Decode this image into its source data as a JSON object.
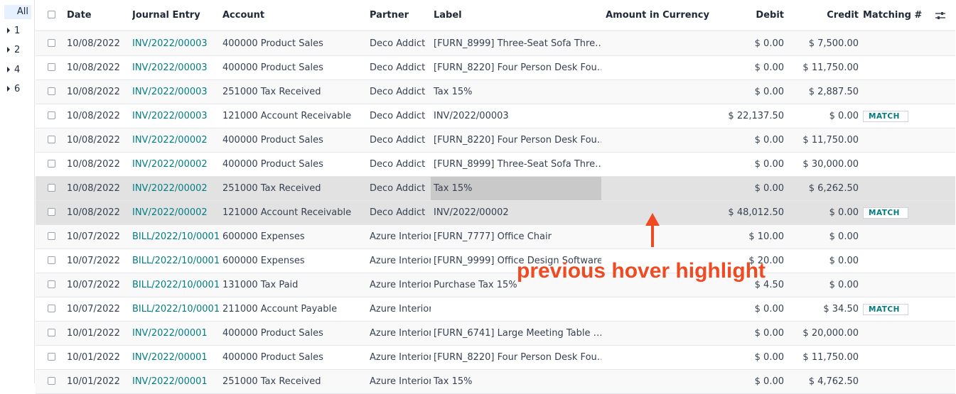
{
  "sidebar": {
    "all_label": "All",
    "groups": [
      "1",
      "2",
      "4",
      "6"
    ]
  },
  "columns": {
    "date": "Date",
    "journal_entry": "Journal Entry",
    "account": "Account",
    "partner": "Partner",
    "label": "Label",
    "amount_currency": "Amount in Currency",
    "debit": "Debit",
    "credit": "Credit",
    "matching": "Matching #"
  },
  "match_label": "MATCH",
  "rows": [
    {
      "date": "10/08/2022",
      "entry": "INV/2022/00003",
      "account": "400000 Product Sales",
      "partner": "Deco Addict",
      "label": "[FURN_8999] Three-Seat Sofa Thre…",
      "amount": "",
      "debit": "$ 0.00",
      "credit": "$ 7,500.00",
      "match": ""
    },
    {
      "date": "10/08/2022",
      "entry": "INV/2022/00003",
      "account": "400000 Product Sales",
      "partner": "Deco Addict",
      "label": "[FURN_8220] Four Person Desk Fou…",
      "amount": "",
      "debit": "$ 0.00",
      "credit": "$ 11,750.00",
      "match": ""
    },
    {
      "date": "10/08/2022",
      "entry": "INV/2022/00003",
      "account": "251000 Tax Received",
      "partner": "Deco Addict",
      "label": "Tax 15%",
      "amount": "",
      "debit": "$ 0.00",
      "credit": "$ 2,887.50",
      "match": ""
    },
    {
      "date": "10/08/2022",
      "entry": "INV/2022/00003",
      "account": "121000 Account Receivable",
      "partner": "Deco Addict",
      "label": "INV/2022/00003",
      "amount": "",
      "debit": "$ 22,137.50",
      "credit": "$ 0.00",
      "match": "MATCH"
    },
    {
      "date": "10/08/2022",
      "entry": "INV/2022/00002",
      "account": "400000 Product Sales",
      "partner": "Deco Addict",
      "label": "[FURN_8220] Four Person Desk Fou…",
      "amount": "",
      "debit": "$ 0.00",
      "credit": "$ 11,750.00",
      "match": ""
    },
    {
      "date": "10/08/2022",
      "entry": "INV/2022/00002",
      "account": "400000 Product Sales",
      "partner": "Deco Addict",
      "label": "[FURN_8999] Three-Seat Sofa Thre…",
      "amount": "",
      "debit": "$ 0.00",
      "credit": "$ 30,000.00",
      "match": ""
    },
    {
      "date": "10/08/2022",
      "entry": "INV/2022/00002",
      "account": "251000 Tax Received",
      "partner": "Deco Addict",
      "label": "Tax 15%",
      "amount": "",
      "debit": "$ 0.00",
      "credit": "$ 6,262.50",
      "match": ""
    },
    {
      "date": "10/08/2022",
      "entry": "INV/2022/00002",
      "account": "121000 Account Receivable",
      "partner": "Deco Addict",
      "label": "INV/2022/00002",
      "amount": "",
      "debit": "$ 48,012.50",
      "credit": "$ 0.00",
      "match": "MATCH"
    },
    {
      "date": "10/07/2022",
      "entry": "BILL/2022/10/0001",
      "account": "600000 Expenses",
      "partner": "Azure Interior",
      "label": "[FURN_7777] Office Chair",
      "amount": "",
      "debit": "$ 10.00",
      "credit": "$ 0.00",
      "match": ""
    },
    {
      "date": "10/07/2022",
      "entry": "BILL/2022/10/0001",
      "account": "600000 Expenses",
      "partner": "Azure Interior",
      "label": "[FURN_9999] Office Design Software",
      "amount": "",
      "debit": "$ 20.00",
      "credit": "$ 0.00",
      "match": ""
    },
    {
      "date": "10/07/2022",
      "entry": "BILL/2022/10/0001",
      "account": "131000 Tax Paid",
      "partner": "Azure Interior",
      "label": "Purchase Tax 15%",
      "amount": "",
      "debit": "$ 4.50",
      "credit": "$ 0.00",
      "match": ""
    },
    {
      "date": "10/07/2022",
      "entry": "BILL/2022/10/0001",
      "account": "211000 Account Payable",
      "partner": "Azure Interior",
      "label": "",
      "amount": "",
      "debit": "$ 0.00",
      "credit": "$ 34.50",
      "match": "MATCH"
    },
    {
      "date": "10/01/2022",
      "entry": "INV/2022/00001",
      "account": "400000 Product Sales",
      "partner": "Azure Interior",
      "label": "[FURN_6741] Large Meeting Table …",
      "amount": "",
      "debit": "$ 0.00",
      "credit": "$ 20,000.00",
      "match": ""
    },
    {
      "date": "10/01/2022",
      "entry": "INV/2022/00001",
      "account": "400000 Product Sales",
      "partner": "Azure Interior",
      "label": "[FURN_8220] Four Person Desk Fou…",
      "amount": "",
      "debit": "$ 0.00",
      "credit": "$ 11,750.00",
      "match": ""
    },
    {
      "date": "10/01/2022",
      "entry": "INV/2022/00001",
      "account": "251000 Tax Received",
      "partner": "Azure Interior",
      "label": "Tax 15%",
      "amount": "",
      "debit": "$ 0.00",
      "credit": "$ 4,762.50",
      "match": ""
    }
  ],
  "hovered_rows": [
    6,
    7
  ],
  "annotation": {
    "text": "previous hover highlight",
    "color": "#f04a23"
  },
  "colors": {
    "link": "#017e84",
    "hover_row": "#e2e2e2",
    "annotation": "#f04a23"
  },
  "icons": {
    "column_toggle": "sliders-icon",
    "group_caret": "caret-right-icon"
  }
}
